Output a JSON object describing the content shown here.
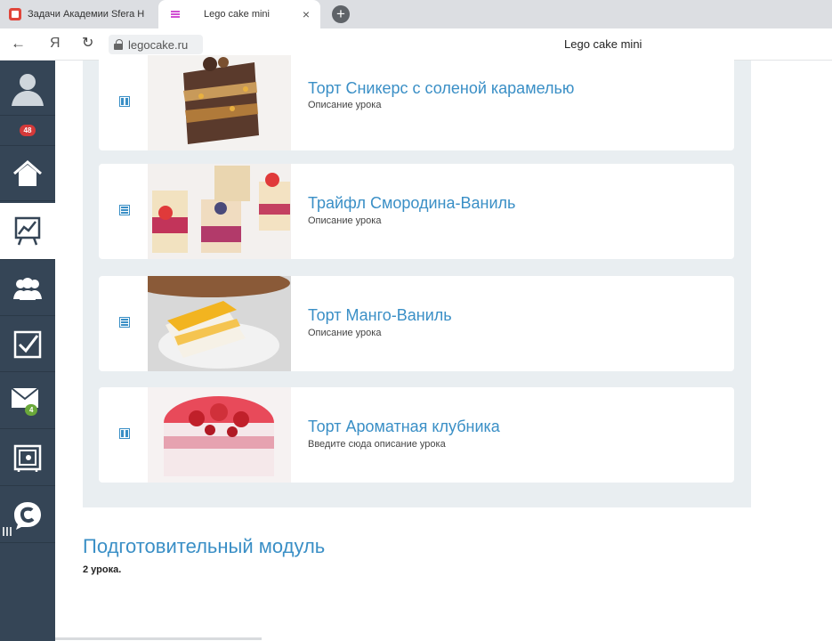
{
  "browser": {
    "tabs": [
      {
        "title": "Задачи Академии Sfera Н",
        "active": false
      },
      {
        "title": "Lego cake mini",
        "active": true
      }
    ],
    "tab_close": "×",
    "new_tab": "+",
    "nav": {
      "back": "←",
      "ya": "Я",
      "reload": "↻"
    },
    "url": "legocake.ru",
    "page_title": "Lego cake mini"
  },
  "sidebar": {
    "notifications_badge": "48",
    "mail_badge": "4",
    "items": [
      {
        "name": "home",
        "icon": "home-icon"
      },
      {
        "name": "chart",
        "icon": "chart-icon",
        "active": true
      },
      {
        "name": "users",
        "icon": "users-icon"
      },
      {
        "name": "tasks",
        "icon": "checkbox-icon"
      },
      {
        "name": "mail",
        "icon": "mail-icon"
      },
      {
        "name": "safe",
        "icon": "safe-icon"
      },
      {
        "name": "chat",
        "icon": "chat-icon"
      }
    ]
  },
  "lessons": [
    {
      "title": "Торт Сникерс с соленой карамелью",
      "description": "Описание урока"
    },
    {
      "title": "Трайфл Смородина-Ваниль",
      "description": "Описание урока"
    },
    {
      "title": "Торт Манго-Ваниль",
      "description": "Описание урока"
    },
    {
      "title": "Торт Ароматная клубника",
      "description": "Введите сюда описание урока"
    }
  ],
  "module": {
    "title": "Подготовительный модуль",
    "count": "2 урока."
  },
  "colors": {
    "sidebar": "#354556",
    "accent": "#3a8fc6",
    "panel": "#e9eef1"
  }
}
